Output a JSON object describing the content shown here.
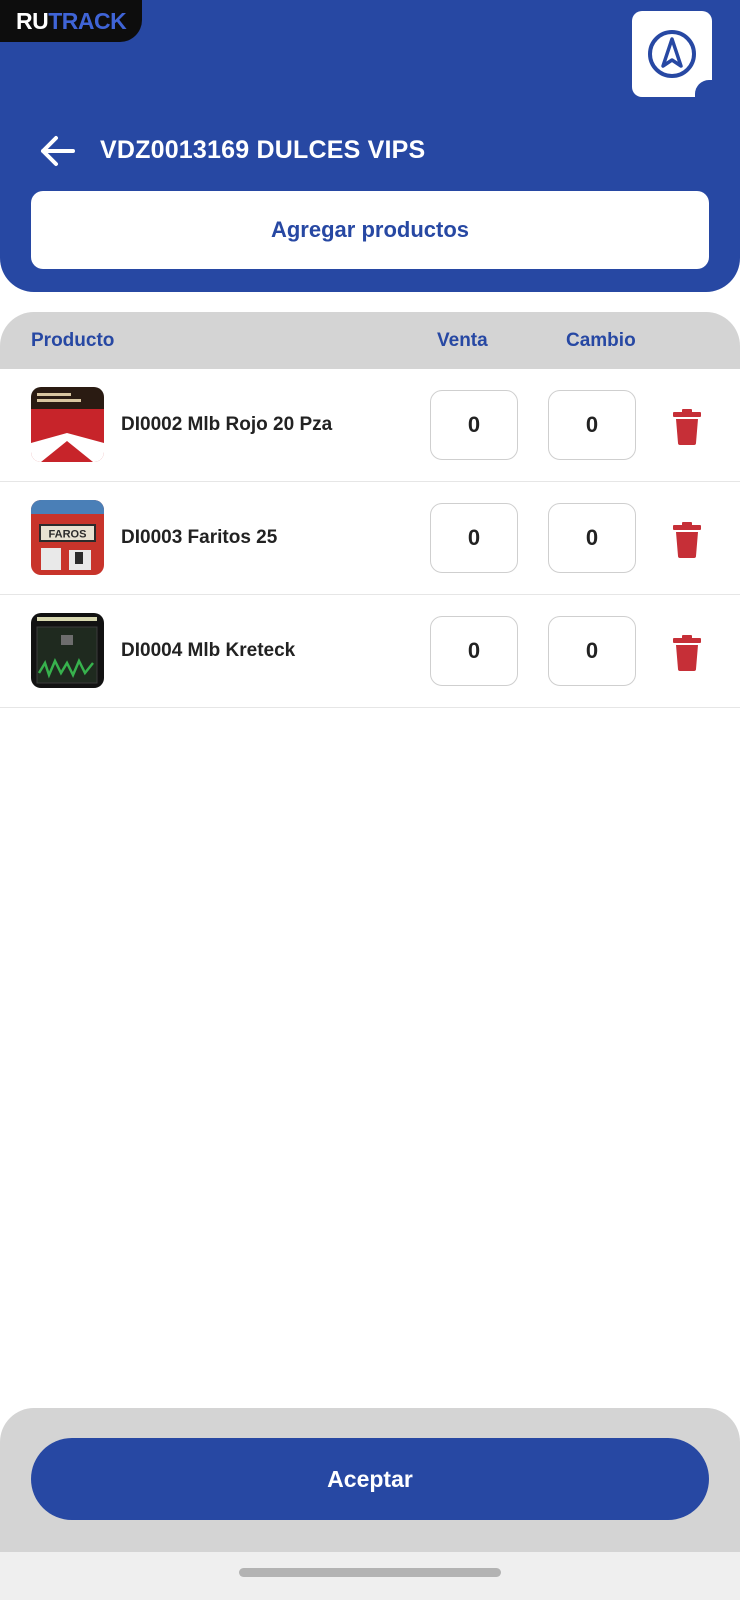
{
  "brand": {
    "part1": "RU",
    "part2": "TRACK"
  },
  "header": {
    "title": "VDZ0013169 DULCES VIPS",
    "add_products_label": "Agregar productos"
  },
  "table": {
    "col_product": "Producto",
    "col_venta": "Venta",
    "col_cambio": "Cambio",
    "rows": [
      {
        "name": "DI0002 Mlb Rojo 20 Pza",
        "venta": "0",
        "cambio": "0",
        "thumb": "marlboro-red-pack"
      },
      {
        "name": "DI0003 Faritos 25",
        "venta": "0",
        "cambio": "0",
        "thumb": "faros-pack"
      },
      {
        "name": "DI0004 Mlb Kreteck",
        "venta": "0",
        "cambio": "0",
        "thumb": "kretek-pack"
      }
    ]
  },
  "footer": {
    "accept_label": "Aceptar"
  },
  "colors": {
    "primary": "#2748a3",
    "delete": "#c62f37",
    "header_bg": "#d4d4d4"
  },
  "icons": {
    "back": "arrow-left-icon",
    "nav": "navigation-compass-icon",
    "delete": "trash-icon"
  }
}
